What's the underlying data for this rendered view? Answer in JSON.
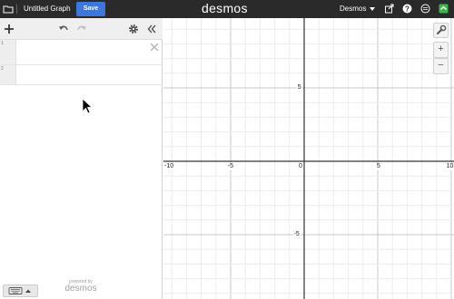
{
  "topbar": {
    "graph_title": "Untitled Graph",
    "save_label": "Save",
    "logo": "desmos",
    "account_label": "Desmos",
    "icons": [
      "folder-icon",
      "share-icon",
      "help-icon",
      "language-icon",
      "shortcut-icon"
    ],
    "colors": {
      "bar": "#2a2a2a",
      "save": "#3c77dc",
      "shortcut": "#3bb54a"
    }
  },
  "expression_panel": {
    "toolbar_icons": [
      "add-icon",
      "undo-icon",
      "redo-icon",
      "gear-icon",
      "collapse-icon"
    ],
    "expressions": [
      {
        "index": "1",
        "value": ""
      },
      {
        "index": "2",
        "value": ""
      }
    ],
    "powered_by": "powered by",
    "powered_logo": "desmos"
  },
  "graph": {
    "x_range": [
      -11,
      11
    ],
    "y_range": [
      -9,
      9
    ],
    "minor_step": 1,
    "major_step": 5,
    "x_tick_labels": [
      {
        "value": -10,
        "text": "-10"
      },
      {
        "value": -5,
        "text": "-5"
      },
      {
        "value": 5,
        "text": "5"
      },
      {
        "value": 10,
        "text": "10"
      }
    ],
    "y_tick_labels": [
      {
        "value": 5,
        "text": "5"
      },
      {
        "value": -5,
        "text": "-5"
      }
    ],
    "origin_label": "0",
    "zoom_in_label": "+",
    "zoom_out_label": "−",
    "colors": {
      "minor": "#ececec",
      "major": "#c9c9c9",
      "axis": "#333333"
    }
  }
}
